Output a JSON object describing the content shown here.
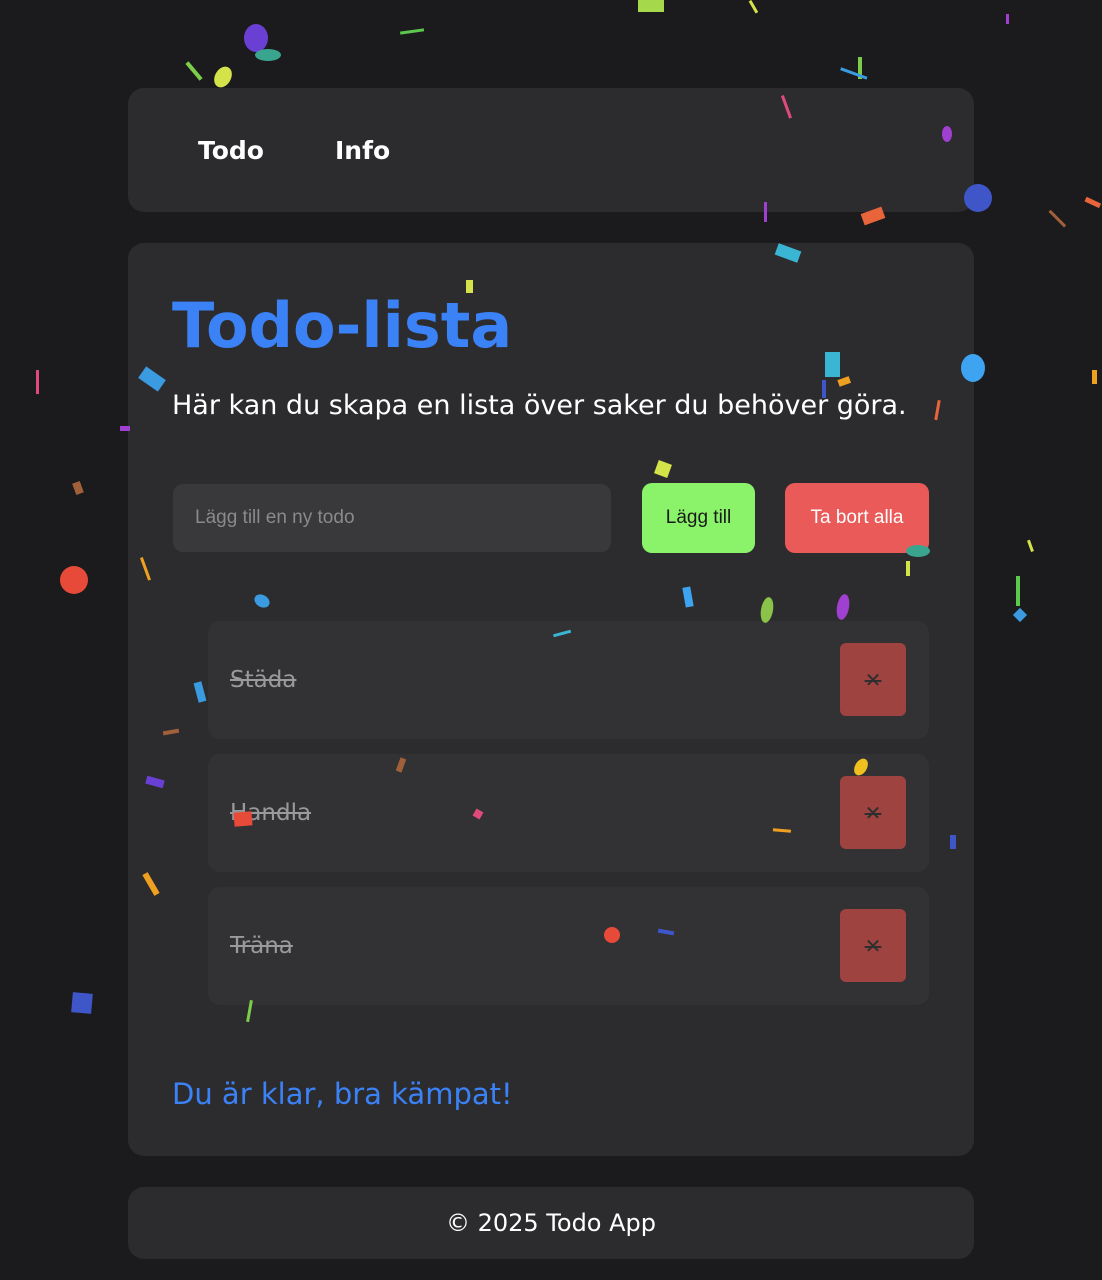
{
  "nav": {
    "items": [
      "Todo",
      "Info"
    ]
  },
  "main": {
    "title": "Todo-lista",
    "subtitle": "Här kan du skapa en lista över saker du behöver göra.",
    "input_placeholder": "Lägg till en ny todo",
    "input_value": "",
    "add_label": "Lägg till",
    "clear_label": "Ta bort alla",
    "todos": [
      {
        "text": "Städa",
        "completed": true,
        "delete_icon": "✕"
      },
      {
        "text": "Handla",
        "completed": true,
        "delete_icon": "✕"
      },
      {
        "text": "Träna",
        "completed": true,
        "delete_icon": "✕"
      }
    ],
    "done_message": "Du är klar, bra kämpat!"
  },
  "footer": {
    "text": "© 2025 Todo App"
  },
  "colors": {
    "accent": "#3b82f6",
    "add_button": "#8af36a",
    "clear_button": "#e95a58",
    "delete_button": "#9f4341"
  }
}
